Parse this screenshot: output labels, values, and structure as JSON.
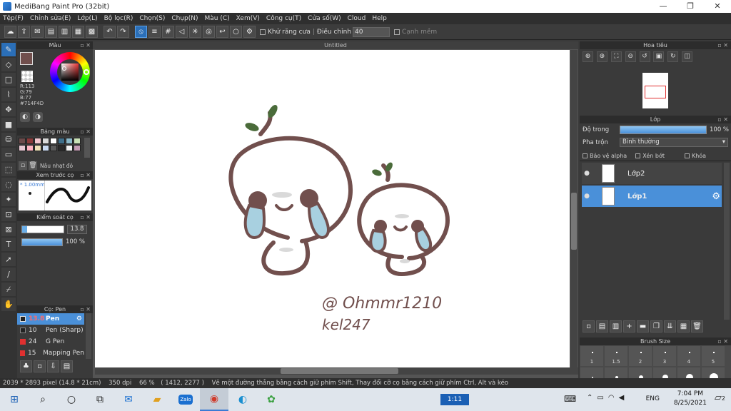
{
  "window": {
    "title": "MediBang Paint Pro (32bit)",
    "controls": [
      "—",
      "❐",
      "✕"
    ]
  },
  "menu": [
    "Tệp(F)",
    "Chỉnh sửa(E)",
    "Lớp(L)",
    "Bộ lọc(R)",
    "Chọn(S)",
    "Chụp(N)",
    "Màu (C)",
    "Xem(V)",
    "Công cụ(T)",
    "Cửa số(W)",
    "Cloud",
    "Help"
  ],
  "toolbar": {
    "antialias_label": "Khử răng cưa",
    "adjust_label": "Điều chỉnh",
    "adjust_value": "40",
    "edge_label": "Cạnh mềm"
  },
  "panels": {
    "color": {
      "title": "Màu",
      "r": "R:113",
      "g": "G:79",
      "b": "B:77",
      "hex": "#714F4D",
      "main_color": "#714F4D"
    },
    "palette": {
      "title": "Bảng màu",
      "swatches": [
        "#6b4a4a",
        "#8a3a3a",
        "#f2c8cf",
        "#d9d9d9",
        "#ffffff",
        "#3f6f8a",
        "#8ab8c9",
        "#c9e1b6",
        "#e8c8d3",
        "#ffb3c0",
        "#efe3b8",
        "#c9d9f0",
        "#5a5a5a",
        "#2a2a2a",
        "#f2f2f2",
        "#c39bb3"
      ],
      "recent_label": "Nâu nhạt đỏ"
    },
    "brush_preview": {
      "title": "Xem trước cọ",
      "size": "* 1.00mm"
    },
    "brush_control": {
      "title": "Kiểm soát cọ",
      "size_value": "13.8",
      "size_fill": 0.12,
      "opacity_value": "100 %"
    },
    "brush_list": {
      "title": "Cọ: Pen",
      "items": [
        {
          "size": "13.8",
          "name": "Pen",
          "color": "#4a90d9"
        },
        {
          "size": "10",
          "name": "Pen (Sharp)",
          "color": "#222222"
        },
        {
          "size": "24",
          "name": "G Pen",
          "color": "#e03030"
        },
        {
          "size": "15",
          "name": "Mapping Pen",
          "color": "#e03030"
        }
      ]
    }
  },
  "canvas": {
    "title": "Untitled",
    "signature_line1": "@ Ohmmr1210",
    "signature_line2": "kel247"
  },
  "navigator": {
    "title": "Hoa tiêu"
  },
  "layers": {
    "title": "Lớp",
    "opacity_label": "Độ trong",
    "opacity_value": "100 %",
    "opacity_fill": 1.0,
    "blend_label": "Pha trộn",
    "blend_value": "Bình thường",
    "protect_alpha": "Bảo vệ alpha",
    "clip": "Xén bớt",
    "lock": "Khóa",
    "items": [
      {
        "name": "Lớp2",
        "selected": false
      },
      {
        "name": "Lớp1",
        "selected": true
      }
    ]
  },
  "brush_size": {
    "title": "Brush Size",
    "labels": [
      "1",
      "1.5",
      "2",
      "3",
      "4",
      "5"
    ]
  },
  "status": {
    "dims": "2039 * 2893 pixel",
    "cm": "(14.8 * 21cm)",
    "dpi": "350 dpi",
    "zoom": "66 %",
    "coords": "( 1412, 2277 )",
    "hint": "Vẽ một đường thẳng bằng cách giữ phím Shift, Thay đổi cỡ cọ bằng cách giữ phím Ctrl, Alt và kéo"
  },
  "taskbar": {
    "timer": "1:11",
    "lang": "ENG",
    "time": "7:04 PM",
    "date": "8/25/2021",
    "notif_count": "2",
    "zalo": "Zalo"
  }
}
